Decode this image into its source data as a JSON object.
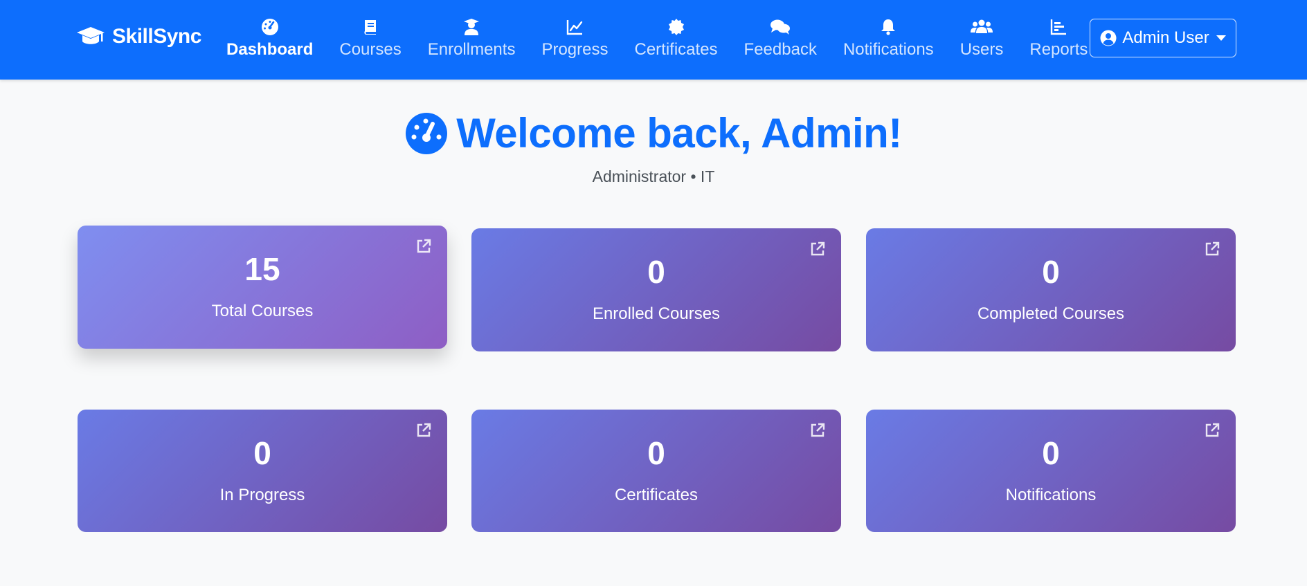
{
  "navbar": {
    "brand": "SkillSync",
    "items": [
      {
        "label": "Dashboard",
        "icon": "tachometer-icon",
        "active": true
      },
      {
        "label": "Courses",
        "icon": "book-icon"
      },
      {
        "label": "Enrollments",
        "icon": "graduate-icon"
      },
      {
        "label": "Progress",
        "icon": "chart-line-icon"
      },
      {
        "label": "Certificates",
        "icon": "certificate-icon"
      },
      {
        "label": "Feedback",
        "icon": "comments-icon"
      },
      {
        "label": "Notifications",
        "icon": "bell-icon"
      },
      {
        "label": "Users",
        "icon": "users-icon"
      },
      {
        "label": "Reports",
        "icon": "bar-chart-icon"
      }
    ],
    "user_menu": "Admin User"
  },
  "header": {
    "title": "Welcome back, Admin!",
    "subtitle": "Administrator • IT"
  },
  "stats": [
    {
      "value": "15",
      "label": "Total Courses"
    },
    {
      "value": "0",
      "label": "Enrolled Courses"
    },
    {
      "value": "0",
      "label": "Completed Courses"
    },
    {
      "value": "0",
      "label": "In Progress"
    },
    {
      "value": "0",
      "label": "Certificates"
    },
    {
      "value": "0",
      "label": "Notifications"
    }
  ],
  "colors": {
    "primary": "#0d6efd",
    "card_gradient_start": "#667eea",
    "card_gradient_end": "#764ba2",
    "background": "#f8f9fa"
  }
}
